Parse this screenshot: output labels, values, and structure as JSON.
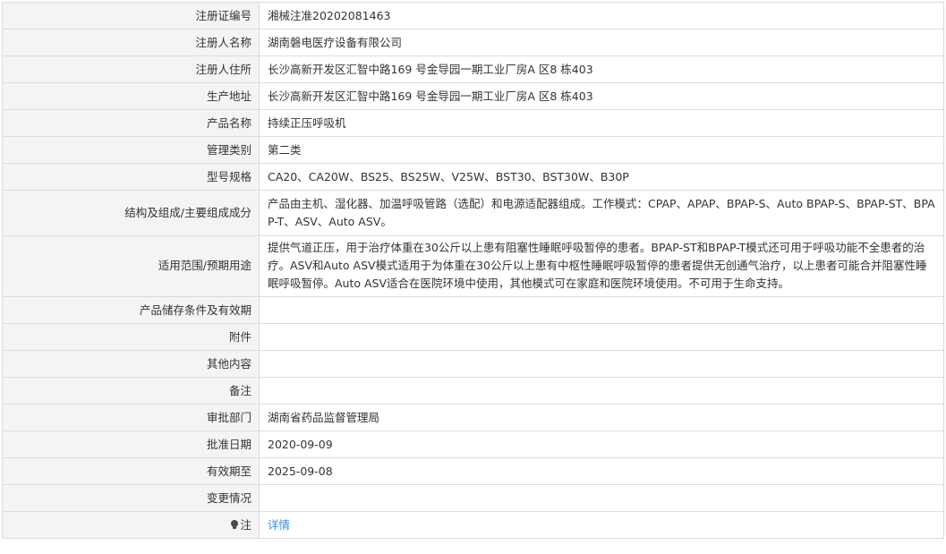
{
  "rows": [
    {
      "label": "注册证编号",
      "value": "湘械注准20202081463"
    },
    {
      "label": "注册人名称",
      "value": "湖南磐电医疗设备有限公司"
    },
    {
      "label": "注册人住所",
      "value": "长沙高新开发区汇智中路169 号金导园一期工业厂房A 区8 栋403"
    },
    {
      "label": "生产地址",
      "value": "长沙高新开发区汇智中路169 号金导园一期工业厂房A 区8 栋403"
    },
    {
      "label": "产品名称",
      "value": "持续正压呼吸机"
    },
    {
      "label": "管理类别",
      "value": "第二类"
    },
    {
      "label": "型号规格",
      "value": "CA20、CA20W、BS25、BS25W、V25W、BST30、BST30W、B30P"
    },
    {
      "label": "结构及组成/主要组成成分",
      "value": "产品由主机、湿化器、加温呼吸管路（选配）和电源适配器组成。工作模式：CPAP、APAP、BPAP-S、Auto BPAP-S、BPAP-ST、BPAP-T、ASV、Auto ASV。"
    },
    {
      "label": "适用范围/预期用途",
      "value": "提供气道正压，用于治疗体重在30公斤以上患有阻塞性睡眠呼吸暂停的患者。BPAP-ST和BPAP-T模式还可用于呼吸功能不全患者的治疗。ASV和Auto ASV模式适用于为体重在30公斤以上患有中枢性睡眠呼吸暂停的患者提供无创通气治疗，以上患者可能合并阻塞性睡眠呼吸暂停。Auto ASV适合在医院环境中使用，其他模式可在家庭和医院环境使用。不可用于生命支持。"
    },
    {
      "label": "产品储存条件及有效期",
      "value": ""
    },
    {
      "label": "附件",
      "value": ""
    },
    {
      "label": "其他内容",
      "value": ""
    },
    {
      "label": "备注",
      "value": ""
    },
    {
      "label": "审批部门",
      "value": "湖南省药品监督管理局"
    },
    {
      "label": "批准日期",
      "value": "2020-09-09"
    },
    {
      "label": "有效期至",
      "value": "2025-09-08"
    },
    {
      "label": "变更情况",
      "value": ""
    }
  ],
  "note": {
    "label": "注",
    "link_text": "详情",
    "icon": "lightbulb-icon"
  }
}
